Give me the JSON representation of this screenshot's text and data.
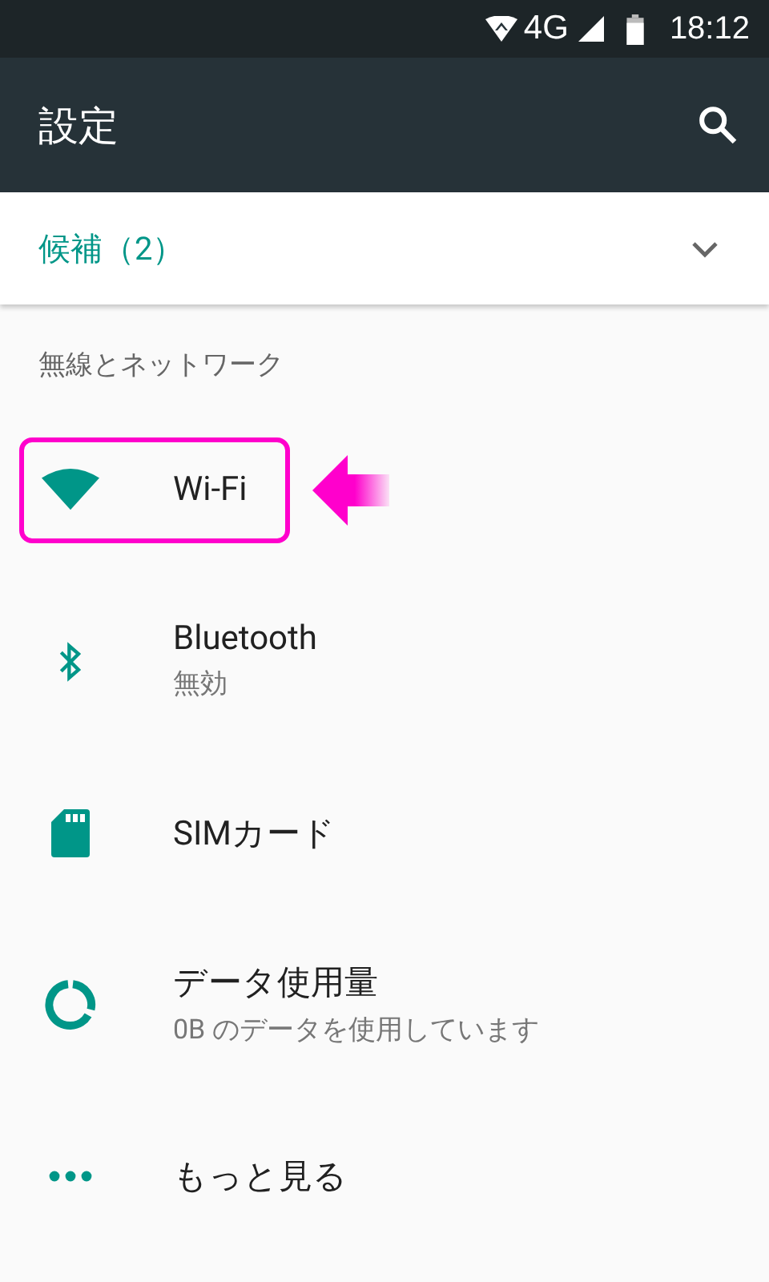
{
  "status_bar": {
    "network": "4G",
    "time": "18:12"
  },
  "toolbar": {
    "title": "設定"
  },
  "suggestions": {
    "label": "候補（2）",
    "expanded": false
  },
  "section": {
    "header": "無線とネットワーク"
  },
  "items": [
    {
      "kind": "wifi",
      "title": "Wi-Fi",
      "highlighted": true
    },
    {
      "kind": "bluetooth",
      "title": "Bluetooth",
      "summary": "無効",
      "highlighted": false
    },
    {
      "kind": "sim",
      "title": "SIMカード",
      "highlighted": false
    },
    {
      "kind": "data",
      "title": "データ使用量",
      "summary": "0B のデータを使用しています",
      "highlighted": false
    },
    {
      "kind": "more",
      "title": "もっと見る",
      "highlighted": false
    }
  ]
}
